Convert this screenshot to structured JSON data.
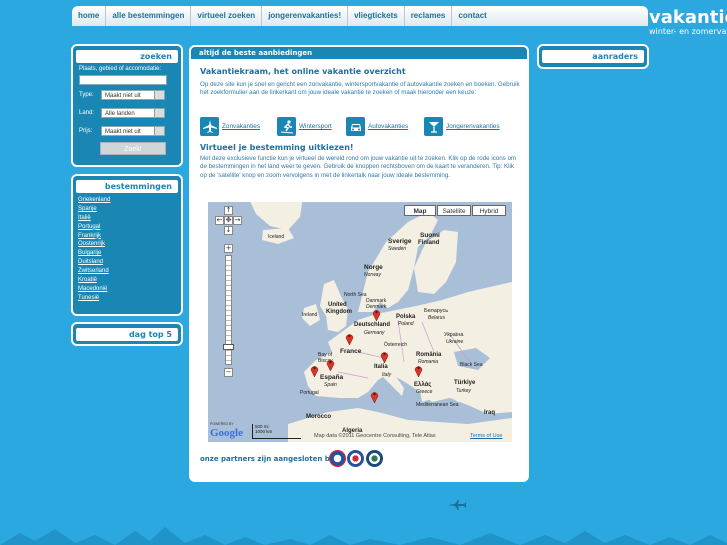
{
  "nav": {
    "items": [
      "home",
      "alle bestemmingen",
      "virtueel zoeken",
      "jongerenvakanties!",
      "vliegtickets",
      "reclames",
      "contact"
    ]
  },
  "logo": {
    "main": "vakantie",
    "sub": "winter- en zomervakanties"
  },
  "zoeken": {
    "title": "zoeken",
    "place_label": "Plaats, gebied of accomodatie:",
    "place_value": "",
    "type_label": "Type:",
    "type_value": "Maakt niet uit",
    "land_label": "Land:",
    "land_value": "Alle landen",
    "prijs_label": "Prijs:",
    "prijs_value": "Maakt niet uit",
    "button": "Zoek!"
  },
  "bestemmingen": {
    "title": "bestemmingen",
    "items": [
      "Griekenland",
      "Spanje",
      "Italië",
      "Portugal",
      "Frankrijk",
      "Oostenrijk",
      "Bulgarije",
      "Duitsland",
      "Zwitserland",
      "Kroatië",
      "Macedonië",
      "Tunesië"
    ]
  },
  "dagtop": {
    "title": "dag top 5"
  },
  "aanraders": {
    "title": "aanraders"
  },
  "main": {
    "header": "altijd de beste aanbiedingen",
    "title": "Vakantiekraam, het online vakantie overzicht",
    "intro": "Op deze site kun je snel en gericht een zonvakantie, wintersportvakantie of autovakantie zoeken en boeken. Gebruik het zoekformulier aan de linkerkant om jouw ideale vakantie te zoeken of maak hieronder een keuze:",
    "categories": [
      {
        "label": "Zonvakanties",
        "icon": "plane-icon"
      },
      {
        "label": "Wintersport",
        "icon": "skier-icon"
      },
      {
        "label": "Autovakanties",
        "icon": "car-icon"
      },
      {
        "label": "Jongerenvakanties",
        "icon": "cocktail-icon"
      }
    ],
    "virtual_title": "Virtueel je bestemming uitkiezen!",
    "virtual_text": "Met deze exclusieve functie kun je virtueel de wereld rond om jouw vakantie uit te zoeken. Klik op de rode icons om de bestemmingen in het land weer te geven. Gebruik de knoppen rechtsboven om de kaart te veranderen. Tip: Klik op de 'satellite' knop en zoom vervolgens in met de linkertalk naar jouw ideale bestemming.",
    "partners": "onze partners zijn aangesloten bij:"
  },
  "map": {
    "buttons": [
      "Map",
      "Satellite",
      "Hybrid"
    ],
    "active_button": "Map",
    "labels": [
      {
        "text": "Iceland",
        "name": "iceland"
      },
      {
        "text": "Sverige",
        "name": "sverige"
      },
      {
        "text": "Sweden",
        "name": "sweden"
      },
      {
        "text": "Suomi",
        "name": "suomi"
      },
      {
        "text": "Finland",
        "name": "finland"
      },
      {
        "text": "Norge",
        "name": "norge"
      },
      {
        "text": "Norway",
        "name": "norway"
      },
      {
        "text": "North Sea",
        "name": "north-sea"
      },
      {
        "text": "Danmark",
        "name": "danmark"
      },
      {
        "text": "Denmark",
        "name": "denmark"
      },
      {
        "text": "United",
        "name": "united"
      },
      {
        "text": "Kingdom",
        "name": "kingdom"
      },
      {
        "text": "Ireland",
        "name": "ireland"
      },
      {
        "text": "Deutschland",
        "name": "deutschland"
      },
      {
        "text": "Germany",
        "name": "germany"
      },
      {
        "text": "Polska",
        "name": "polska"
      },
      {
        "text": "Poland",
        "name": "poland"
      },
      {
        "text": "Беларусь",
        "name": "belarus-native"
      },
      {
        "text": "Belarus",
        "name": "belarus"
      },
      {
        "text": "Україна",
        "name": "ukraine-native"
      },
      {
        "text": "Ukraine",
        "name": "ukraine"
      },
      {
        "text": "France",
        "name": "france"
      },
      {
        "text": "Österreich",
        "name": "osterreich"
      },
      {
        "text": "Bay of",
        "name": "bay-of"
      },
      {
        "text": "Biscay",
        "name": "biscay"
      },
      {
        "text": "România",
        "name": "romania-native"
      },
      {
        "text": "Romania",
        "name": "romania"
      },
      {
        "text": "Italia",
        "name": "italia"
      },
      {
        "text": "Italy",
        "name": "italy"
      },
      {
        "text": "Black Sea",
        "name": "black-sea"
      },
      {
        "text": "España",
        "name": "espana"
      },
      {
        "text": "Spain",
        "name": "spain"
      },
      {
        "text": "Portugal",
        "name": "portugal"
      },
      {
        "text": "Ελλάς",
        "name": "ellas"
      },
      {
        "text": "Greece",
        "name": "greece"
      },
      {
        "text": "Türkiye",
        "name": "turkiye"
      },
      {
        "text": "Turkey",
        "name": "turkey"
      },
      {
        "text": "Mediterranean Sea",
        "name": "mediterranean-sea"
      },
      {
        "text": "Iraq",
        "name": "iraq"
      },
      {
        "text": "Morocco",
        "name": "morocco"
      },
      {
        "text": "Algeria",
        "name": "algeria"
      }
    ],
    "powered_by": "POWERED BY",
    "google": "Google",
    "scale_mi": "500 mi",
    "scale_km": "1000 km",
    "copyright": "Map data ©2011 Geocentre Consulting, Tele Atlas",
    "terms": "Terms of Use"
  },
  "colors": {
    "background": "#2aa8df",
    "panel": "#1a86b4",
    "link": "#1e6fa0",
    "pin": "#d8352a"
  }
}
